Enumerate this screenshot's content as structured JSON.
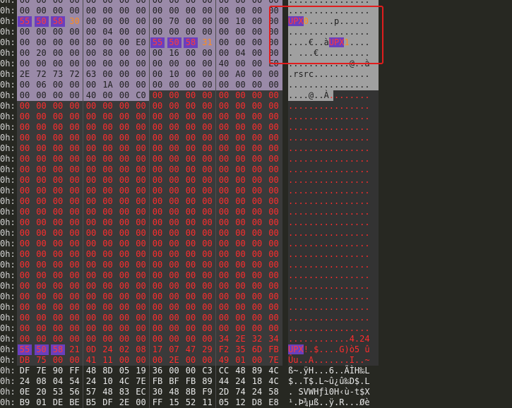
{
  "offset_label": "0h:",
  "rows": [
    {
      "bg": "ov",
      "hex": [
        "00",
        "00",
        "00",
        "00",
        "00",
        "00",
        "00",
        "00",
        "00",
        "00",
        "00",
        "00",
        "00",
        "00",
        "00",
        "00"
      ],
      "color": "dark",
      "ascii": "................",
      "acolor": "dark"
    },
    {
      "bg": "ov",
      "hex": [
        "00",
        "00",
        "00",
        "00",
        "00",
        "00",
        "00",
        "00",
        "00",
        "00",
        "00",
        "00",
        "00",
        "00",
        "00",
        "00"
      ],
      "color": "dark",
      "ascii": "................",
      "acolor": "dark"
    },
    {
      "bg": "ov",
      "hex": [
        "55",
        "50",
        "58",
        "30",
        "00",
        "00",
        "00",
        "00",
        "00",
        "70",
        "00",
        "00",
        "00",
        "10",
        "00",
        "00"
      ],
      "color": "dark",
      "ascii": "UPX0.....p......",
      "acolor": "dark",
      "hl": [
        0,
        1,
        2
      ],
      "orange": [
        3
      ],
      "ahl": [
        0,
        3
      ],
      "aorange": [
        3,
        4
      ]
    },
    {
      "bg": "ov",
      "hex": [
        "00",
        "00",
        "00",
        "00",
        "00",
        "04",
        "00",
        "00",
        "00",
        "00",
        "00",
        "00",
        "00",
        "00",
        "00",
        "00"
      ],
      "color": "dark",
      "ascii": "................",
      "acolor": "dark"
    },
    {
      "bg": "ov",
      "hex": [
        "00",
        "00",
        "00",
        "00",
        "80",
        "00",
        "00",
        "E0",
        "55",
        "50",
        "58",
        "31",
        "00",
        "00",
        "00",
        "00"
      ],
      "color": "dark",
      "ascii": "....€..àUPX1....",
      "acolor": "dark",
      "hl": [
        8,
        9,
        10
      ],
      "orange": [
        11
      ],
      "ahl": [
        8,
        11
      ],
      "aorange": [
        11,
        12
      ]
    },
    {
      "bg": "ov",
      "hex": [
        "00",
        "20",
        "00",
        "00",
        "00",
        "80",
        "00",
        "00",
        "00",
        "16",
        "00",
        "00",
        "00",
        "04",
        "00",
        "00"
      ],
      "color": "dark",
      "ascii": ". ...€..........",
      "acolor": "dark"
    },
    {
      "bg": "ov",
      "hex": [
        "00",
        "00",
        "00",
        "00",
        "00",
        "00",
        "00",
        "00",
        "00",
        "00",
        "00",
        "00",
        "40",
        "00",
        "00",
        "E0"
      ],
      "color": "dark",
      "ascii": "............@..à",
      "acolor": "dark"
    },
    {
      "bg": "ov",
      "hex": [
        "2E",
        "72",
        "73",
        "72",
        "63",
        "00",
        "00",
        "00",
        "00",
        "10",
        "00",
        "00",
        "00",
        "A0",
        "00",
        "00"
      ],
      "color": "dark",
      "ascii": ".rsrc...........",
      "acolor": "dark"
    },
    {
      "bg": "ov",
      "hex": [
        "00",
        "06",
        "00",
        "00",
        "00",
        "1A",
        "00",
        "00",
        "00",
        "00",
        "00",
        "00",
        "00",
        "00",
        "00",
        "00"
      ],
      "color": "dark",
      "ascii": "................",
      "acolor": "dark"
    },
    {
      "bg": "ovsplit",
      "split": 8,
      "hex": [
        "00",
        "00",
        "00",
        "00",
        "40",
        "00",
        "00",
        "C0",
        "00",
        "00",
        "00",
        "00",
        "00",
        "00",
        "00",
        "00"
      ],
      "color": "dark",
      "ascii": "....@..À........",
      "acolor": "dark"
    },
    {
      "bg": "dk",
      "hex": [
        "00",
        "00",
        "00",
        "00",
        "00",
        "00",
        "00",
        "00",
        "00",
        "00",
        "00",
        "00",
        "00",
        "00",
        "00",
        "00"
      ],
      "color": "red",
      "ascii": "................",
      "acolor": "red"
    },
    {
      "bg": "dk",
      "hex": [
        "00",
        "00",
        "00",
        "00",
        "00",
        "00",
        "00",
        "00",
        "00",
        "00",
        "00",
        "00",
        "00",
        "00",
        "00",
        "00"
      ],
      "color": "red",
      "ascii": "................",
      "acolor": "red"
    },
    {
      "bg": "dk",
      "hex": [
        "00",
        "00",
        "00",
        "00",
        "00",
        "00",
        "00",
        "00",
        "00",
        "00",
        "00",
        "00",
        "00",
        "00",
        "00",
        "00"
      ],
      "color": "red",
      "ascii": "................",
      "acolor": "red"
    },
    {
      "bg": "dk",
      "hex": [
        "00",
        "00",
        "00",
        "00",
        "00",
        "00",
        "00",
        "00",
        "00",
        "00",
        "00",
        "00",
        "00",
        "00",
        "00",
        "00"
      ],
      "color": "red",
      "ascii": "................",
      "acolor": "red"
    },
    {
      "bg": "dk",
      "hex": [
        "00",
        "00",
        "00",
        "00",
        "00",
        "00",
        "00",
        "00",
        "00",
        "00",
        "00",
        "00",
        "00",
        "00",
        "00",
        "00"
      ],
      "color": "red",
      "ascii": "................",
      "acolor": "red"
    },
    {
      "bg": "dk",
      "hex": [
        "00",
        "00",
        "00",
        "00",
        "00",
        "00",
        "00",
        "00",
        "00",
        "00",
        "00",
        "00",
        "00",
        "00",
        "00",
        "00"
      ],
      "color": "red",
      "ascii": "................",
      "acolor": "red"
    },
    {
      "bg": "dk",
      "hex": [
        "00",
        "00",
        "00",
        "00",
        "00",
        "00",
        "00",
        "00",
        "00",
        "00",
        "00",
        "00",
        "00",
        "00",
        "00",
        "00"
      ],
      "color": "red",
      "ascii": "................",
      "acolor": "red"
    },
    {
      "bg": "dk",
      "hex": [
        "00",
        "00",
        "00",
        "00",
        "00",
        "00",
        "00",
        "00",
        "00",
        "00",
        "00",
        "00",
        "00",
        "00",
        "00",
        "00"
      ],
      "color": "red",
      "ascii": "................",
      "acolor": "red"
    },
    {
      "bg": "dk",
      "hex": [
        "00",
        "00",
        "00",
        "00",
        "00",
        "00",
        "00",
        "00",
        "00",
        "00",
        "00",
        "00",
        "00",
        "00",
        "00",
        "00"
      ],
      "color": "red",
      "ascii": "................",
      "acolor": "red"
    },
    {
      "bg": "dk",
      "hex": [
        "00",
        "00",
        "00",
        "00",
        "00",
        "00",
        "00",
        "00",
        "00",
        "00",
        "00",
        "00",
        "00",
        "00",
        "00",
        "00"
      ],
      "color": "red",
      "ascii": "................",
      "acolor": "red"
    },
    {
      "bg": "dk",
      "hex": [
        "00",
        "00",
        "00",
        "00",
        "00",
        "00",
        "00",
        "00",
        "00",
        "00",
        "00",
        "00",
        "00",
        "00",
        "00",
        "00"
      ],
      "color": "red",
      "ascii": "................",
      "acolor": "red"
    },
    {
      "bg": "dk",
      "hex": [
        "00",
        "00",
        "00",
        "00",
        "00",
        "00",
        "00",
        "00",
        "00",
        "00",
        "00",
        "00",
        "00",
        "00",
        "00",
        "00"
      ],
      "color": "red",
      "ascii": "................",
      "acolor": "red"
    },
    {
      "bg": "dk",
      "hex": [
        "00",
        "00",
        "00",
        "00",
        "00",
        "00",
        "00",
        "00",
        "00",
        "00",
        "00",
        "00",
        "00",
        "00",
        "00",
        "00"
      ],
      "color": "red",
      "ascii": "................",
      "acolor": "red"
    },
    {
      "bg": "dk",
      "hex": [
        "00",
        "00",
        "00",
        "00",
        "00",
        "00",
        "00",
        "00",
        "00",
        "00",
        "00",
        "00",
        "00",
        "00",
        "00",
        "00"
      ],
      "color": "red",
      "ascii": "................",
      "acolor": "red"
    },
    {
      "bg": "dk",
      "hex": [
        "00",
        "00",
        "00",
        "00",
        "00",
        "00",
        "00",
        "00",
        "00",
        "00",
        "00",
        "00",
        "00",
        "00",
        "00",
        "00"
      ],
      "color": "red",
      "ascii": "................",
      "acolor": "red"
    },
    {
      "bg": "dk",
      "hex": [
        "00",
        "00",
        "00",
        "00",
        "00",
        "00",
        "00",
        "00",
        "00",
        "00",
        "00",
        "00",
        "00",
        "00",
        "00",
        "00"
      ],
      "color": "red",
      "ascii": "................",
      "acolor": "red"
    },
    {
      "bg": "dk",
      "hex": [
        "00",
        "00",
        "00",
        "00",
        "00",
        "00",
        "00",
        "00",
        "00",
        "00",
        "00",
        "00",
        "00",
        "00",
        "00",
        "00"
      ],
      "color": "red",
      "ascii": "................",
      "acolor": "red"
    },
    {
      "bg": "dk",
      "hex": [
        "00",
        "00",
        "00",
        "00",
        "00",
        "00",
        "00",
        "00",
        "00",
        "00",
        "00",
        "00",
        "00",
        "00",
        "00",
        "00"
      ],
      "color": "red",
      "ascii": "................",
      "acolor": "red"
    },
    {
      "bg": "dk",
      "hex": [
        "00",
        "00",
        "00",
        "00",
        "00",
        "00",
        "00",
        "00",
        "00",
        "00",
        "00",
        "00",
        "00",
        "00",
        "00",
        "00"
      ],
      "color": "red",
      "ascii": "................",
      "acolor": "red"
    },
    {
      "bg": "dk",
      "hex": [
        "00",
        "00",
        "00",
        "00",
        "00",
        "00",
        "00",
        "00",
        "00",
        "00",
        "00",
        "00",
        "00",
        "00",
        "00",
        "00"
      ],
      "color": "red",
      "ascii": "................",
      "acolor": "red"
    },
    {
      "bg": "dk",
      "hex": [
        "00",
        "00",
        "00",
        "00",
        "00",
        "00",
        "00",
        "00",
        "00",
        "00",
        "00",
        "00",
        "00",
        "00",
        "00",
        "00"
      ],
      "color": "red",
      "ascii": "................",
      "acolor": "red"
    },
    {
      "bg": "dk",
      "hex": [
        "00",
        "00",
        "00",
        "00",
        "00",
        "00",
        "00",
        "00",
        "00",
        "00",
        "00",
        "00",
        "00",
        "00",
        "00",
        "00"
      ],
      "color": "red",
      "ascii": "................",
      "acolor": "red"
    },
    {
      "bg": "dk",
      "hex": [
        "00",
        "00",
        "00",
        "00",
        "00",
        "00",
        "00",
        "00",
        "00",
        "00",
        "00",
        "00",
        "34",
        "2E",
        "32",
        "34"
      ],
      "color": "red",
      "ascii": "............4.24",
      "acolor": "red"
    },
    {
      "bg": "dk",
      "hex": [
        "55",
        "50",
        "58",
        "21",
        "0D",
        "24",
        "02",
        "08",
        "17",
        "07",
        "47",
        "29",
        "F2",
        "35",
        "6D",
        "FB"
      ],
      "color": "red",
      "ascii": "UPX!.$....G)ò5 û",
      "acolor": "red",
      "hl": [
        0,
        1,
        2
      ],
      "ahl": [
        0,
        3
      ]
    },
    {
      "bg": "dk",
      "hex": [
        "DB",
        "75",
        "00",
        "00",
        "41",
        "11",
        "00",
        "00",
        "00",
        "2E",
        "00",
        "00",
        "49",
        "01",
        "00",
        "7E"
      ],
      "color": "red",
      "ascii": "Ûu..A.......I..~",
      "acolor": "red"
    },
    {
      "bg": "clr",
      "hex": [
        "DF",
        "7E",
        "90",
        "FF",
        "48",
        "8D",
        "05",
        "19",
        "36",
        "00",
        "00",
        "C3",
        "CC",
        "48",
        "89",
        "4C"
      ],
      "color": "white",
      "ascii": "ß~.ÿH...6..ÃÌH‰L",
      "acolor": "white"
    },
    {
      "bg": "clr",
      "hex": [
        "24",
        "08",
        "04",
        "54",
        "24",
        "10",
        "4C",
        "7E",
        "FB",
        "BF",
        "FB",
        "89",
        "44",
        "24",
        "18",
        "4C"
      ],
      "color": "white",
      "ascii": "$..T$.L~û¿û‰D$.L",
      "acolor": "white"
    },
    {
      "bg": "clr",
      "hex": [
        "0E",
        "20",
        "53",
        "56",
        "57",
        "48",
        "83",
        "EC",
        "30",
        "48",
        "8B",
        "F9",
        "2D",
        "74",
        "24",
        "58"
      ],
      "color": "white",
      "ascii": ". SVWHƒì0H‹ù-t$X",
      "acolor": "white"
    },
    {
      "bg": "clr",
      "hex": [
        "B9",
        "01",
        "DE",
        "BE",
        "B5",
        "DF",
        "2E",
        "00",
        "FF",
        "15",
        "52",
        "11",
        "05",
        "12",
        "D8",
        "E8"
      ],
      "color": "white",
      "ascii": "¹.Þ¾µß..ÿ.R...Øè",
      "acolor": "white"
    }
  ]
}
